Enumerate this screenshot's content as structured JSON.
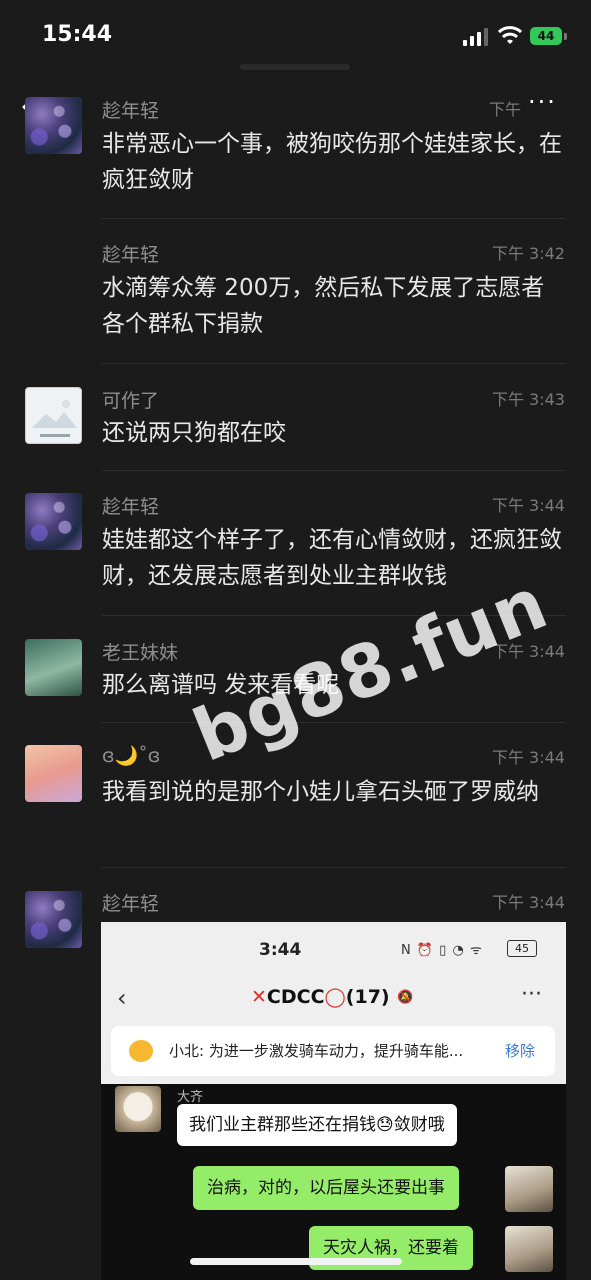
{
  "status_bar": {
    "time": "15:44",
    "battery": "44"
  },
  "header": {
    "back_icon": "chevron-left-icon",
    "more_label": "···",
    "more_icon": "more-dots-icon"
  },
  "messages": [
    {
      "sender": "趁年轻",
      "time": "下午",
      "text": "非常恶心一个事，被狗咬伤那个娃娃家长，在疯狂敛财"
    },
    {
      "sender": "趁年轻",
      "time": "下午 3:42",
      "text": "水滴筹众筹 200万，然后私下发展了志愿者各个群私下捐款"
    },
    {
      "sender": "可作了",
      "time": "下午 3:43",
      "text": "还说两只狗都在咬"
    },
    {
      "sender": "趁年轻",
      "time": "下午 3:44",
      "text": "娃娃都这个样子了，还有心情敛财，还疯狂敛财，还发展志愿者到处业主群收钱"
    },
    {
      "sender": "老王妹妹",
      "time": "下午 3:44",
      "text": "那么离谱吗 发来看看呢"
    },
    {
      "sender": "ɞ🌙˚ɞ",
      "time": "下午 3:44",
      "text": "我看到说的是那个小娃儿拿石头砸了罗威纳"
    },
    {
      "sender": "趁年轻",
      "time": "下午 3:44",
      "text": ""
    }
  ],
  "screenshot": {
    "time": "3:44",
    "status_icons": "N ⏰ ▯ ◔ ᯤ",
    "battery": "45",
    "back": "‹",
    "group_title_mark": "✕",
    "group_title": "CDCC",
    "group_title_mark2": "◯",
    "group_count": "(17)",
    "mute_icon": "bell-slash-icon",
    "more": "···",
    "notice": "小北: 为进一步激发骑车动力，提升骑车能...",
    "notice_action": "移除",
    "chat": {
      "sender": "大齐",
      "incoming": "我们业主群那些还在捐钱😓敛财哦",
      "outgoing": [
        "治病，对的，以后屋头还要出事",
        "天灾人祸，还要着"
      ]
    }
  },
  "watermark": "bg88.fun"
}
